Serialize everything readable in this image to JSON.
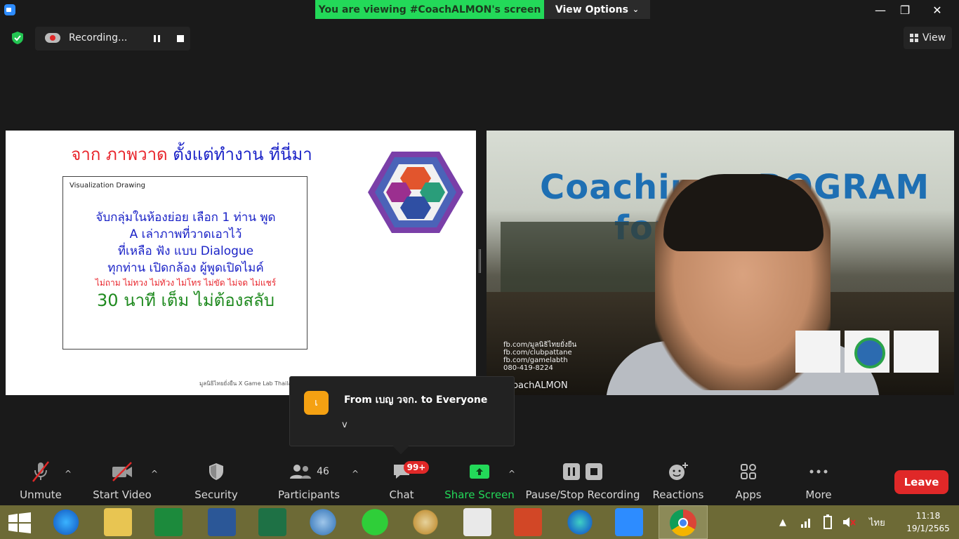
{
  "titlebar": {
    "banner": "You are viewing #CoachALMON's screen",
    "view_options": "View Options",
    "minimize": "—",
    "restore": "❐",
    "close": "✕"
  },
  "recording": {
    "label": "Recording..."
  },
  "view_button": {
    "label": "View"
  },
  "slide": {
    "title_red": "จาก ภาพวาด",
    "title_blue": "ตั้งแต่ทำงาน ที่นี่มา",
    "box_label": "Visualization Drawing",
    "line1": "จับกลุ่มในห้องย่อย เลือก 1 ท่าน พูด",
    "line2": "A เล่าภาพที่วาดเอาไว้",
    "line3": "ที่เหลือ ฟัง แบบ Dialogue",
    "line4": "ทุกท่าน เปิดกล้อง ผู้พูดเปิดไมค์",
    "line5": "ไม่ถาม ไม่ทวง ไม่ทัวง ไม่โทร ไม่ขัด ไม่จด ไม่แชร์",
    "line6": "30 นาที เต็ม ไม่ต้องสลับ",
    "footer": "มูลนิธิไทยยั่งยืน X Game Lab Thailand"
  },
  "video": {
    "bg_line1": "Coaching PROGRAM",
    "bg_line2": "for Leader",
    "contact1": "fb.com/มูลนิธิไทยยั่งยืน",
    "contact2": "fb.com/clubpattane",
    "contact3": "fb.com/gamelabth",
    "contact4": "080-419-8224",
    "name": "CoachALMON"
  },
  "chat_popup": {
    "avatar_letter": "เ",
    "from": "From เบญ วจก. to Everyone",
    "message": "v"
  },
  "toolbar": {
    "unmute": "Unmute",
    "start_video": "Start Video",
    "security": "Security",
    "participants": "Participants",
    "participants_count": "46",
    "chat": "Chat",
    "chat_badge": "99+",
    "share_screen": "Share Screen",
    "pause_stop_recording": "Pause/Stop Recording",
    "reactions": "Reactions",
    "apps": "Apps",
    "more": "More",
    "leave": "Leave"
  },
  "taskbar": {
    "language": "ไทย",
    "time": "11:18",
    "date": "19/1/2565"
  },
  "colors": {
    "banner_green": "#23d959",
    "leave_red": "#e02828",
    "share_green": "#23d959",
    "taskbar": "#6d6a36"
  }
}
